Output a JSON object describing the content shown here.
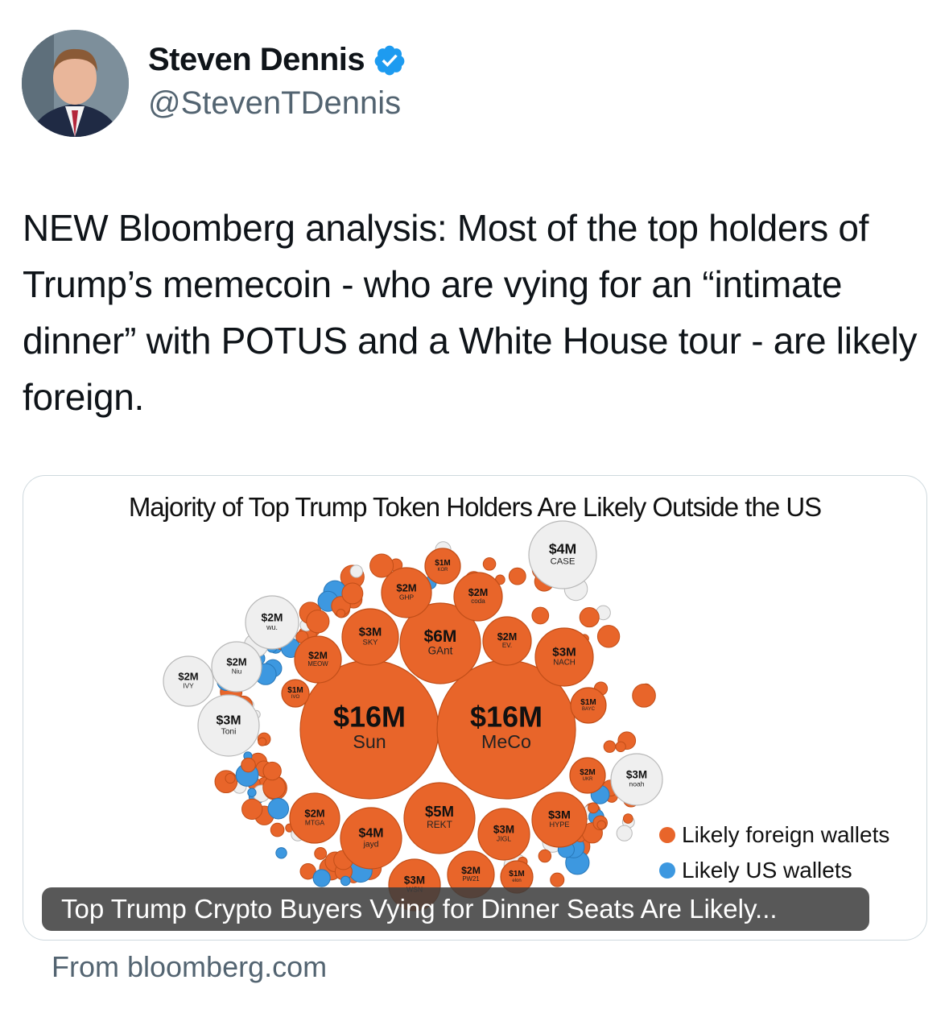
{
  "author": {
    "name": "Steven Dennis",
    "handle": "@StevenTDennis",
    "verified": true,
    "verified_color": "#1d9bf0"
  },
  "tweet": {
    "text": "NEW Bloomberg analysis: Most of the top holders of Trump’s memecoin - who are vying for an “intimate dinner” with POTUS and a White House tour - are likely foreign."
  },
  "card": {
    "overlay_title": "Top Trump Crypto Buyers Vying for Dinner Seats Are Likely...",
    "source": "From bloomberg.com"
  },
  "chart_data": {
    "type": "bubble",
    "title": "Majority of Top Trump Token Holders Are Likely Outside the US",
    "legend": [
      {
        "label": "Likely foreign wallets",
        "color": "#e8652a"
      },
      {
        "label": "Likely US wallets",
        "color": "#3d98e0"
      }
    ],
    "legend_placement": "bottom-right",
    "colors": {
      "foreign": "#e8652a",
      "us": "#3d98e0",
      "unknown": "#efefef"
    },
    "labeled_holders": [
      {
        "amount": "$16M",
        "name": "Sun",
        "group": "foreign"
      },
      {
        "amount": "$16M",
        "name": "MeCo",
        "group": "foreign"
      },
      {
        "amount": "$6M",
        "name": "GAnt",
        "group": "foreign"
      },
      {
        "amount": "$5M",
        "name": "REKT",
        "group": "foreign"
      },
      {
        "amount": "$4M",
        "name": "CASE",
        "group": "unknown"
      },
      {
        "amount": "$4M",
        "name": "jayd",
        "group": "foreign"
      },
      {
        "amount": "$3M",
        "name": "SKY",
        "group": "foreign"
      },
      {
        "amount": "$3M",
        "name": "NACH",
        "group": "foreign"
      },
      {
        "amount": "$3M",
        "name": "Toni",
        "group": "unknown"
      },
      {
        "amount": "$3M",
        "name": "noah",
        "group": "unknown"
      },
      {
        "amount": "$3M",
        "name": "HYPE",
        "group": "foreign"
      },
      {
        "amount": "$3M",
        "name": "JIGL",
        "group": "foreign"
      },
      {
        "amount": "$3M",
        "name": "WSN",
        "group": "foreign"
      },
      {
        "amount": "$2M",
        "name": "GHP",
        "group": "foreign"
      },
      {
        "amount": "$2M",
        "name": "coda",
        "group": "foreign"
      },
      {
        "amount": "$2M",
        "name": "wu.",
        "group": "unknown"
      },
      {
        "amount": "$2M",
        "name": "MEOW",
        "group": "foreign"
      },
      {
        "amount": "$2M",
        "name": "EV.",
        "group": "foreign"
      },
      {
        "amount": "$2M",
        "name": "Niu",
        "group": "unknown"
      },
      {
        "amount": "$2M",
        "name": "IVY",
        "group": "unknown"
      },
      {
        "amount": "$2M",
        "name": "UKR",
        "group": "foreign"
      },
      {
        "amount": "$2M",
        "name": "MTGA",
        "group": "foreign"
      },
      {
        "amount": "$2M",
        "name": "PW21",
        "group": "foreign"
      },
      {
        "amount": "$1M",
        "name": "KOR",
        "group": "foreign"
      },
      {
        "amount": "$1M",
        "name": "BAYC",
        "group": "foreign"
      },
      {
        "amount": "$1M",
        "name": "IVO",
        "group": "foreign"
      },
      {
        "amount": "$1M",
        "name": "elon",
        "group": "foreign"
      }
    ]
  }
}
